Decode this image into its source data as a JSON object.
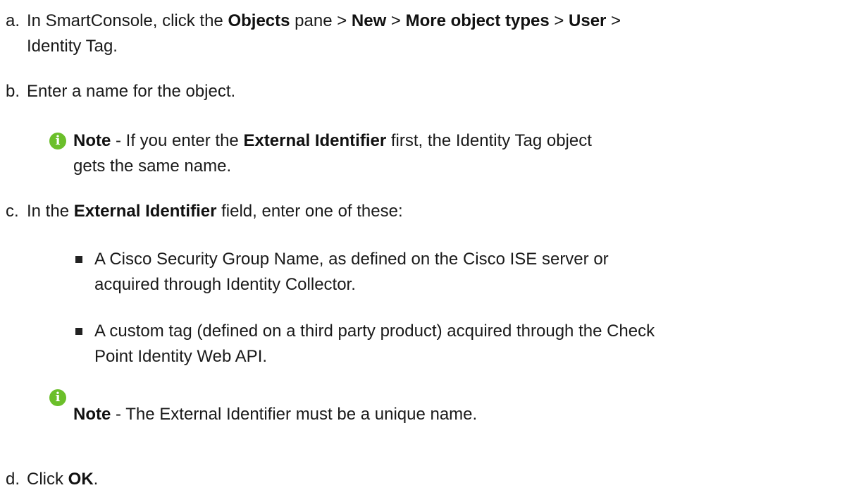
{
  "steps": [
    {
      "marker": "a.",
      "parts": [
        "In SmartConsole, click the ",
        "Objects",
        " pane > ",
        "New",
        " > ",
        "More object types",
        " > ",
        "User",
        " >"
      ],
      "line2": "Identity Tag."
    },
    {
      "marker": "b.",
      "text": "Enter a name for the object.",
      "note": {
        "label": "Note",
        "line1_a": " - If you enter the ",
        "line1_b": "External Identifier",
        "line1_c": " first, the Identity Tag object",
        "line2": "gets the same name."
      }
    },
    {
      "marker": "c.",
      "parts": [
        "In the ",
        "External Identifier",
        " field, enter one of these:"
      ],
      "bullets": [
        {
          "line1": "A Cisco Security Group Name, as defined on the Cisco ISE server or",
          "line2": "acquired through Identity Collector."
        },
        {
          "line1": "A custom tag (defined on a third party product) acquired through the Check",
          "line2": "Point Identity Web API."
        }
      ],
      "note": {
        "label": "Note",
        "text": " - The External Identifier must be a unique name."
      }
    },
    {
      "marker": "d.",
      "parts": [
        "Click ",
        "OK",
        "."
      ]
    }
  ],
  "icon": "info-circle-icon",
  "colors": {
    "info_icon": "#6bbf2a",
    "text": "#1a1a1a"
  }
}
